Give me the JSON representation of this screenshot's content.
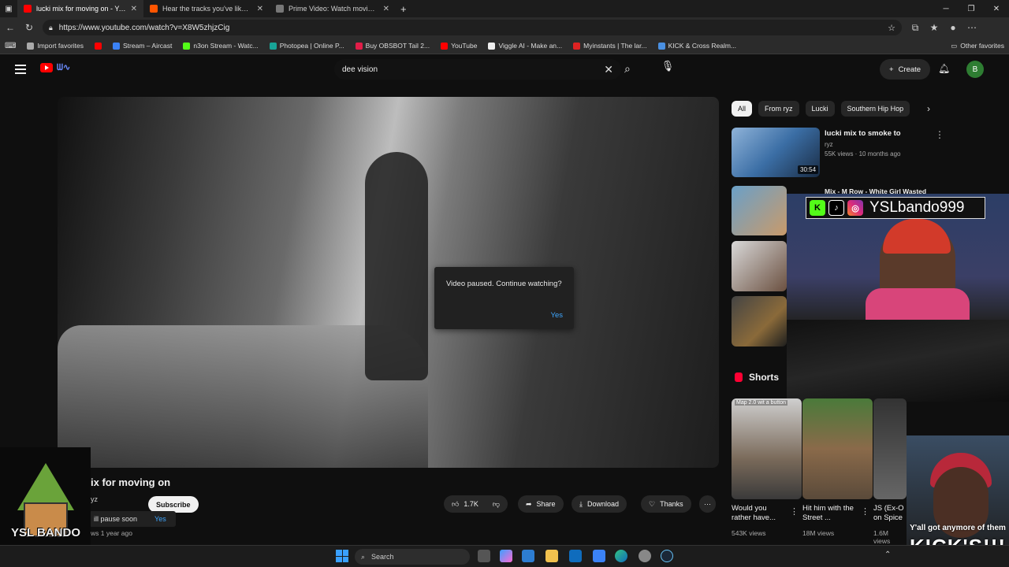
{
  "browser": {
    "tabs": [
      {
        "title": "lucki mix for moving on - YouTub",
        "color": "#ff0000",
        "active": true
      },
      {
        "title": "Hear the tracks you've liked: on S",
        "color": "#ff5500",
        "active": false
      },
      {
        "title": "Prime Video: Watch movies, TV sh",
        "color": "#777777",
        "active": false
      }
    ],
    "new_tab": "+",
    "url": "https://www.youtube.com/watch?v=X8W5zhjzCig",
    "bookmarks": [
      {
        "label": "Import favorites",
        "color": "#aaaaaa"
      },
      {
        "label": "",
        "color": "#ff0000"
      },
      {
        "label": "Stream – Aircast",
        "color": "#3b82f6"
      },
      {
        "label": "n3on Stream - Watc...",
        "color": "#53fc18"
      },
      {
        "label": "Photopea | Online P...",
        "color": "#18a497"
      },
      {
        "label": "Buy OBSBOT Tail 2...",
        "color": "#e11d48"
      },
      {
        "label": "YouTube",
        "color": "#ff0000"
      },
      {
        "label": "Viggle AI - Make an...",
        "color": "#eeeeee"
      },
      {
        "label": "Myinstants | The lar...",
        "color": "#dd2222"
      },
      {
        "label": "KICK & Cross Realm...",
        "color": "#4a90e2"
      }
    ],
    "other_favorites": "Other favorites"
  },
  "youtube": {
    "search_value": "dee vision",
    "create_label": "Create",
    "avatar_letter": "B",
    "video": {
      "pause_message": "Video paused. Continue watching?",
      "pause_yes": "Yes",
      "title_fragment": "ix for moving on",
      "channel_fragment": "yz",
      "subscribe": "Subscribe",
      "likes": "1.7K",
      "share": "Share",
      "download": "Download",
      "thanks": "Thanks",
      "more": "···",
      "toast_text": "ill pause soon",
      "toast_yes": "Yes",
      "views_fragment": "ws",
      "age": "1 year ago"
    },
    "chips": [
      "All",
      "From ryz",
      "Lucki",
      "Southern Hip Hop"
    ],
    "recommendations": [
      {
        "title": "lucki mix to smoke to",
        "channel": "ryz",
        "meta": "55K views · 10 months ago",
        "duration": "30:54"
      },
      {
        "title": "Mix - M Row - White Girl Wasted",
        "channel": "",
        "meta": "",
        "duration": ""
      }
    ],
    "shorts_label": "Shorts",
    "shorts": [
      {
        "caption": "Map 2.0 wit a button",
        "title": "Would you rather have...",
        "views": "543K views"
      },
      {
        "caption": "",
        "title": "Hit him with the Street ...",
        "views": "18M views"
      },
      {
        "caption": "",
        "title": "JS (Ex-O on Spice",
        "views": "1.6M views"
      }
    ]
  },
  "overlay": {
    "handle": "YSLbando999",
    "social_icons": [
      "K",
      "♪",
      "◎"
    ],
    "house_text": "YSL BANDO",
    "caption_line1": "Y'all got anymore of them",
    "caption_line2": "KICK'S!!!"
  },
  "taskbar": {
    "search": "Search"
  }
}
